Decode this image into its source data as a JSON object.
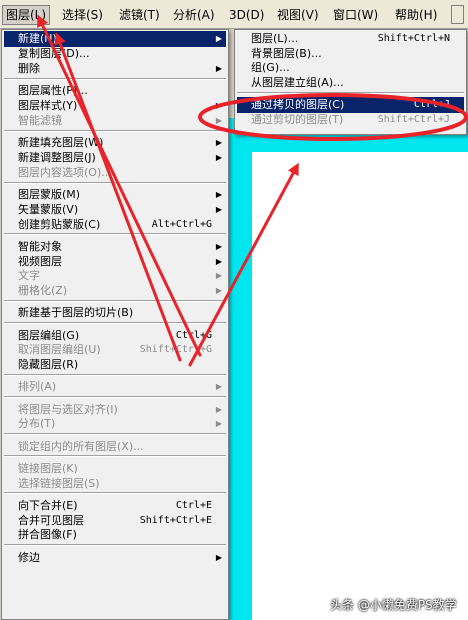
{
  "menubar": {
    "items": [
      {
        "label": "图层(L)",
        "active": true
      },
      {
        "label": "选择(S)"
      },
      {
        "label": "滤镜(T)"
      },
      {
        "label": "分析(A)"
      },
      {
        "label": "3D(D)"
      },
      {
        "label": "视图(V)"
      },
      {
        "label": "窗口(W)"
      },
      {
        "label": "帮助(H)"
      }
    ]
  },
  "layer_menu": {
    "items": [
      {
        "label": "新建(N)",
        "arrow": true,
        "highlight": true
      },
      {
        "label": "复制图层(D)..."
      },
      {
        "label": "删除",
        "arrow": true
      },
      {
        "sep": true
      },
      {
        "label": "图层属性(P)..."
      },
      {
        "label": "图层样式(Y)",
        "arrow": true
      },
      {
        "label": "智能滤镜",
        "arrow": true,
        "disabled": true
      },
      {
        "sep": true
      },
      {
        "label": "新建填充图层(W)",
        "arrow": true
      },
      {
        "label": "新建调整图层(J)",
        "arrow": true
      },
      {
        "label": "图层内容选项(O)...",
        "disabled": true
      },
      {
        "sep": true
      },
      {
        "label": "图层蒙版(M)",
        "arrow": true
      },
      {
        "label": "矢量蒙版(V)",
        "arrow": true
      },
      {
        "label": "创建剪贴蒙版(C)",
        "shortcut": "Alt+Ctrl+G"
      },
      {
        "sep": true
      },
      {
        "label": "智能对象",
        "arrow": true
      },
      {
        "label": "视频图层",
        "arrow": true
      },
      {
        "label": "文字",
        "arrow": true,
        "disabled": true
      },
      {
        "label": "栅格化(Z)",
        "arrow": true,
        "disabled": true
      },
      {
        "sep": true
      },
      {
        "label": "新建基于图层的切片(B)"
      },
      {
        "sep": true
      },
      {
        "label": "图层编组(G)",
        "shortcut": "Ctrl+G"
      },
      {
        "label": "取消图层编组(U)",
        "shortcut": "Shift+Ctrl+G",
        "disabled": true
      },
      {
        "label": "隐藏图层(R)"
      },
      {
        "sep": true
      },
      {
        "label": "排列(A)",
        "arrow": true,
        "disabled": true
      },
      {
        "sep": true
      },
      {
        "label": "将图层与选区对齐(I)",
        "arrow": true,
        "disabled": true
      },
      {
        "label": "分布(T)",
        "arrow": true,
        "disabled": true
      },
      {
        "sep": true
      },
      {
        "label": "锁定组内的所有图层(X)...",
        "disabled": true
      },
      {
        "sep": true
      },
      {
        "label": "链接图层(K)",
        "disabled": true
      },
      {
        "label": "选择链接图层(S)",
        "disabled": true
      },
      {
        "sep": true
      },
      {
        "label": "向下合并(E)",
        "shortcut": "Ctrl+E"
      },
      {
        "label": "合并可见图层",
        "shortcut": "Shift+Ctrl+E"
      },
      {
        "label": "拼合图像(F)"
      },
      {
        "sep": true
      },
      {
        "label": "修边",
        "arrow": true
      }
    ]
  },
  "new_submenu": {
    "items": [
      {
        "label": "图层(L)...",
        "shortcut": "Shift+Ctrl+N"
      },
      {
        "label": "背景图层(B)..."
      },
      {
        "label": "组(G)..."
      },
      {
        "label": "从图层建立组(A)..."
      },
      {
        "sep": true
      },
      {
        "label": "通过拷贝的图层(C)",
        "shortcut": "Ctrl+J",
        "highlight": true
      },
      {
        "label": "通过剪切的图层(T)",
        "shortcut": "Shift+Ctrl+J",
        "disabled": true
      }
    ]
  },
  "watermark": "头条 @小懒免费PS教学",
  "colors": {
    "highlight": "#0a246a",
    "annotation": "#e8232a",
    "canvas_cyan": "#00e5ee"
  }
}
